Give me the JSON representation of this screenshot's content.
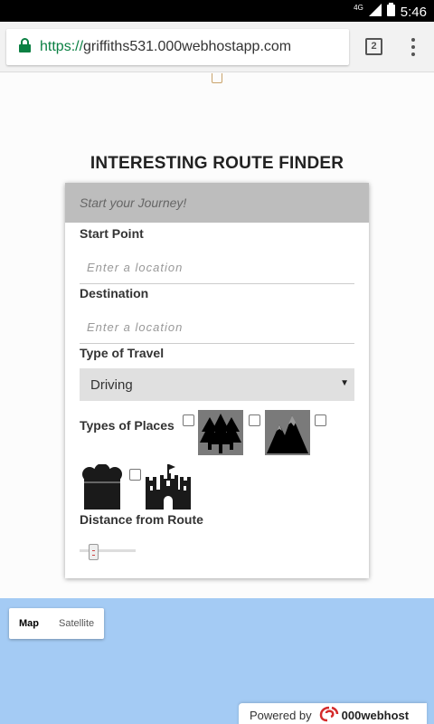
{
  "status_bar": {
    "network": "4G",
    "time": "5:46"
  },
  "browser": {
    "url_scheme": "https://",
    "url_host": "griffiths531.000webhostapp.com",
    "tab_count": "2"
  },
  "page": {
    "title": "INTERESTING ROUTE FINDER",
    "card_header": "Start your Journey!",
    "start_label": "Start Point",
    "start_placeholder": "Enter a location",
    "destination_label": "Destination",
    "destination_placeholder": "Enter a location",
    "travel_label": "Type of Travel",
    "travel_selected": "Driving",
    "places_label": "Types of Places",
    "places": [
      {
        "icon": "forest-icon",
        "checked": false
      },
      {
        "icon": "mountain-icon",
        "checked": false
      },
      {
        "icon": "restaurant-icon",
        "checked": false
      },
      {
        "icon": "castle-icon",
        "checked": false
      }
    ],
    "distance_label": "Distance from Route",
    "distance_value_fraction": 0.2
  },
  "map": {
    "map_button": "Map",
    "satellite_button": "Satellite"
  },
  "footer": {
    "powered_by": "Powered by",
    "brand": "000webhost"
  },
  "colors": {
    "map_water": "#a4cbf4",
    "card_header_bg": "#bdbdbd",
    "url_secure": "#0b8043"
  }
}
